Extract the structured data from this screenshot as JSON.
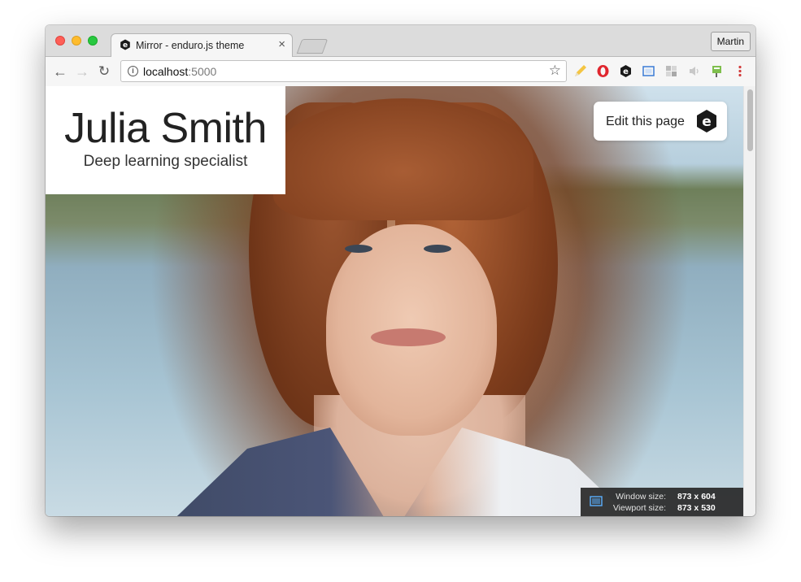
{
  "browser": {
    "tab": {
      "title": "Mirror - enduro.js theme",
      "close": "×"
    },
    "profile": "Martin",
    "address": {
      "host": "localhost",
      "port": ":5000"
    },
    "nav": {
      "back": "←",
      "forward": "→",
      "reload": "↻"
    },
    "star": "☆",
    "extensions": [
      "pencil-extension-icon",
      "opera-extension-icon",
      "enduro-extension-icon",
      "screen-capture-extension-icon",
      "puzzle-extension-icon",
      "speaker-extension-icon",
      "flag-extension-icon",
      "more-menu-icon"
    ]
  },
  "page": {
    "name": "Julia Smith",
    "subtitle": "Deep learning specialist",
    "edit_button": {
      "label": "Edit this page",
      "logo_letter": "e"
    }
  },
  "size_overlay": {
    "window_label": "Window size:",
    "window_value": "873 x 604",
    "viewport_label": "Viewport size:",
    "viewport_value": "873 x 530"
  },
  "colors": {
    "enduro_logo": "#1a1a1a",
    "close_button": "#fe5f57",
    "minimize_button": "#febc2e",
    "maximize_button": "#28c840"
  }
}
